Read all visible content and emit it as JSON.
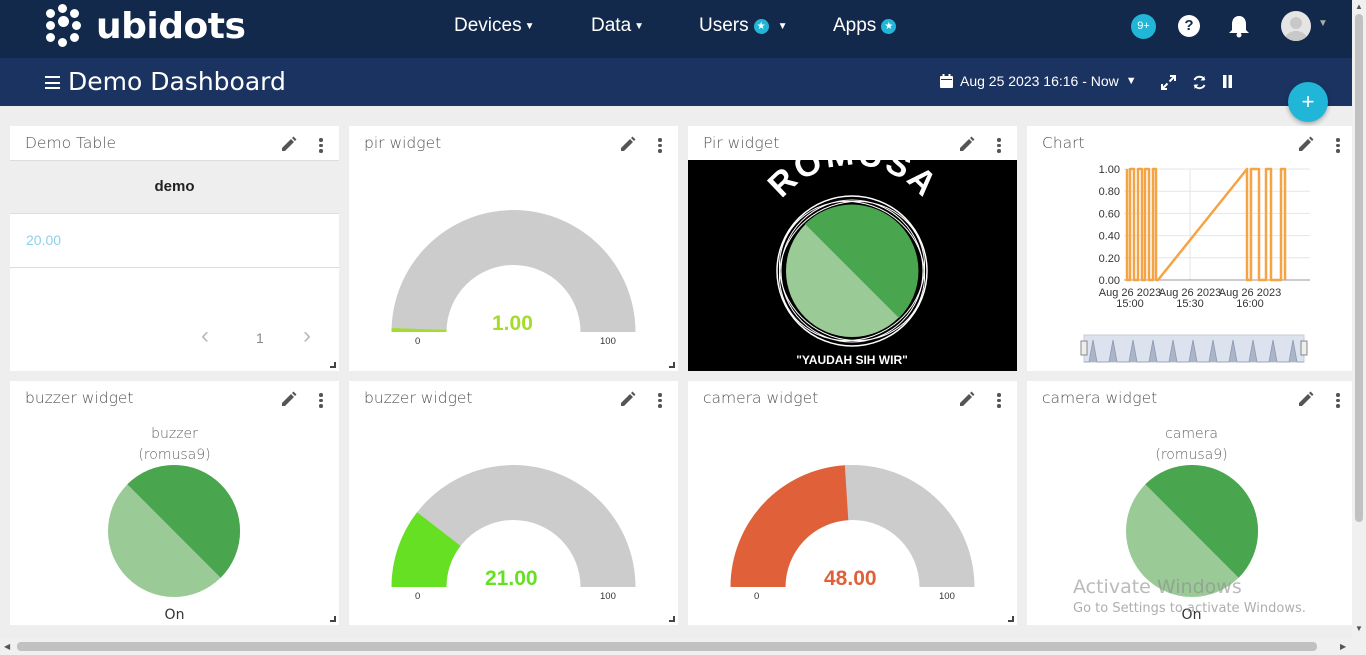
{
  "app": {
    "brand": "ubidots"
  },
  "nav": {
    "devices": "Devices",
    "data": "Data",
    "users": "Users",
    "apps": "Apps",
    "notifications_badge": "9+",
    "help": "?"
  },
  "dashboard": {
    "title": "Demo Dashboard",
    "date_range": "Aug 25 2023 16:16 - Now",
    "add_label": "+"
  },
  "widgets": {
    "demo_table": {
      "title": "Demo Table",
      "column": "demo",
      "value": "20.00",
      "page": "1"
    },
    "pir_gauge": {
      "title": "pir widget",
      "value": "1.00",
      "min": "0",
      "max": "100",
      "fraction": 0.01,
      "color": "#a3dc29"
    },
    "pir_image": {
      "title": "Pir widget",
      "caption_top": "ROMUSA",
      "caption_bottom": "\"YAUDAH SIH WIR\""
    },
    "chart": {
      "title": "Chart"
    },
    "buzzer_pie": {
      "title": "buzzer widget",
      "label": "buzzer",
      "sublabel": "(romusa9)",
      "state": "On"
    },
    "buzzer_gauge": {
      "title": "buzzer widget",
      "value": "21.00",
      "min": "0",
      "max": "100",
      "fraction": 0.21,
      "color": "#66e022"
    },
    "camera_gauge": {
      "title": "camera widget",
      "value": "48.00",
      "min": "0",
      "max": "100",
      "fraction": 0.48,
      "color": "#e0603a"
    },
    "camera_pie": {
      "title": "camera widget",
      "label": "camera",
      "sublabel": "(romusa9)",
      "state": "On"
    }
  },
  "chart_data": {
    "type": "line",
    "x_ticks": [
      "Aug 26 2023 15:00",
      "Aug 26 2023 15:30",
      "Aug 26 2023 16:00"
    ],
    "y_ticks": [
      "1.00",
      "0.80",
      "0.60",
      "0.40",
      "0.20",
      "0.00"
    ],
    "ylim": [
      0,
      1
    ],
    "series_color": "#f5a445"
  },
  "watermark": {
    "line1": "Activate Windows",
    "line2": "Go to Settings to activate Windows."
  }
}
